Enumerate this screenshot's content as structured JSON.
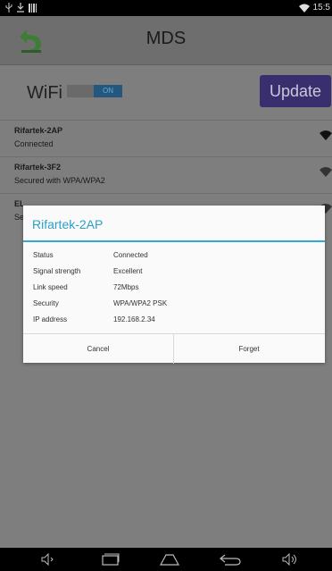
{
  "status_bar": {
    "time": "15:5",
    "icons": [
      "usb-icon",
      "download-icon",
      "barcode-icon",
      "wifi-signal-icon"
    ]
  },
  "app_bar": {
    "title": "MDS",
    "back_icon": "back-arrow-icon"
  },
  "wifi": {
    "label": "WiFi",
    "toggle_state": "ON",
    "update_label": "Update"
  },
  "networks": [
    {
      "name": "Rifartek-2AP",
      "status": "Connected"
    },
    {
      "name": "Rifartek-3F2",
      "status": "Secured with WPA/WPA2"
    },
    {
      "name": "EL",
      "status": "Se"
    }
  ],
  "dialog": {
    "title": "Rifartek-2AP",
    "details": [
      {
        "key": "Status",
        "value": "Connected"
      },
      {
        "key": "Signal strength",
        "value": "Excellent"
      },
      {
        "key": "Link speed",
        "value": "72Mbps"
      },
      {
        "key": "Security",
        "value": "WPA/WPA2 PSK"
      },
      {
        "key": "IP address",
        "value": "192.168.2.34"
      }
    ],
    "cancel_label": "Cancel",
    "forget_label": "Forget"
  },
  "nav_bar": {
    "icons": [
      "volume-down-icon",
      "recent-apps-icon",
      "home-icon",
      "back-icon",
      "volume-up-icon"
    ]
  },
  "colors": {
    "accent": "#33a8d6",
    "update_button": "#3a2f6e",
    "toggle_on": "#24577e"
  }
}
